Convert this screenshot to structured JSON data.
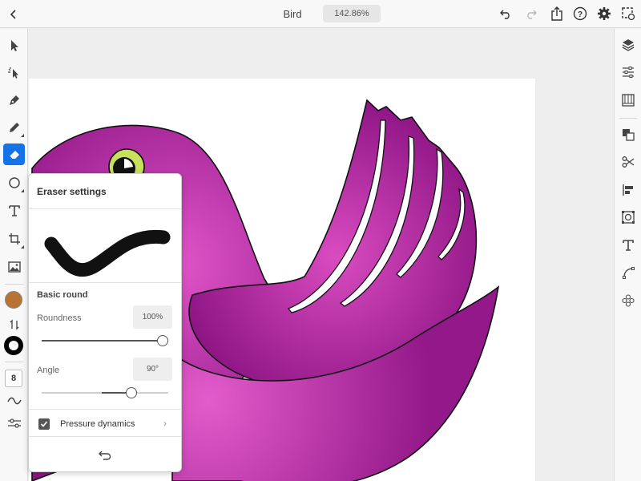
{
  "header": {
    "title": "Bird",
    "zoom": "142.86%",
    "icons": [
      "chevron-left-icon",
      "undo-icon",
      "redo-icon",
      "share-icon",
      "help-icon",
      "gear-icon",
      "artboard-export-icon"
    ]
  },
  "left_toolbar": {
    "tools": [
      "select-icon",
      "direct-select-icon",
      "pen-icon",
      "pencil-icon",
      "eraser-icon",
      "shape-icon",
      "text-icon",
      "transform-icon",
      "image-icon"
    ],
    "active_tool": "eraser-icon",
    "fill_color": "#b87333",
    "stroke_color": "#000000",
    "stroke_size": "8"
  },
  "right_toolbar": {
    "tools": [
      "layers-icon",
      "properties-icon",
      "libraries-icon",
      "arrange-icon",
      "scissors-icon",
      "align-icon",
      "image-trace-icon",
      "type-icon",
      "path-icon",
      "repeat-icon"
    ]
  },
  "eraser_panel": {
    "title": "Eraser settings",
    "brush_name": "Basic round",
    "roundness": {
      "label": "Roundness",
      "value": "100%",
      "level": 1.0
    },
    "angle": {
      "label": "Angle",
      "value": "90°",
      "level": 0.73
    },
    "pressure": {
      "label": "Pressure dynamics",
      "checked": true
    }
  },
  "colors": {
    "accent": "#1473e6",
    "bird_purple": "#9a1f8f",
    "bird_magenta": "#e055c8",
    "eye_green": "#c8e05a"
  }
}
